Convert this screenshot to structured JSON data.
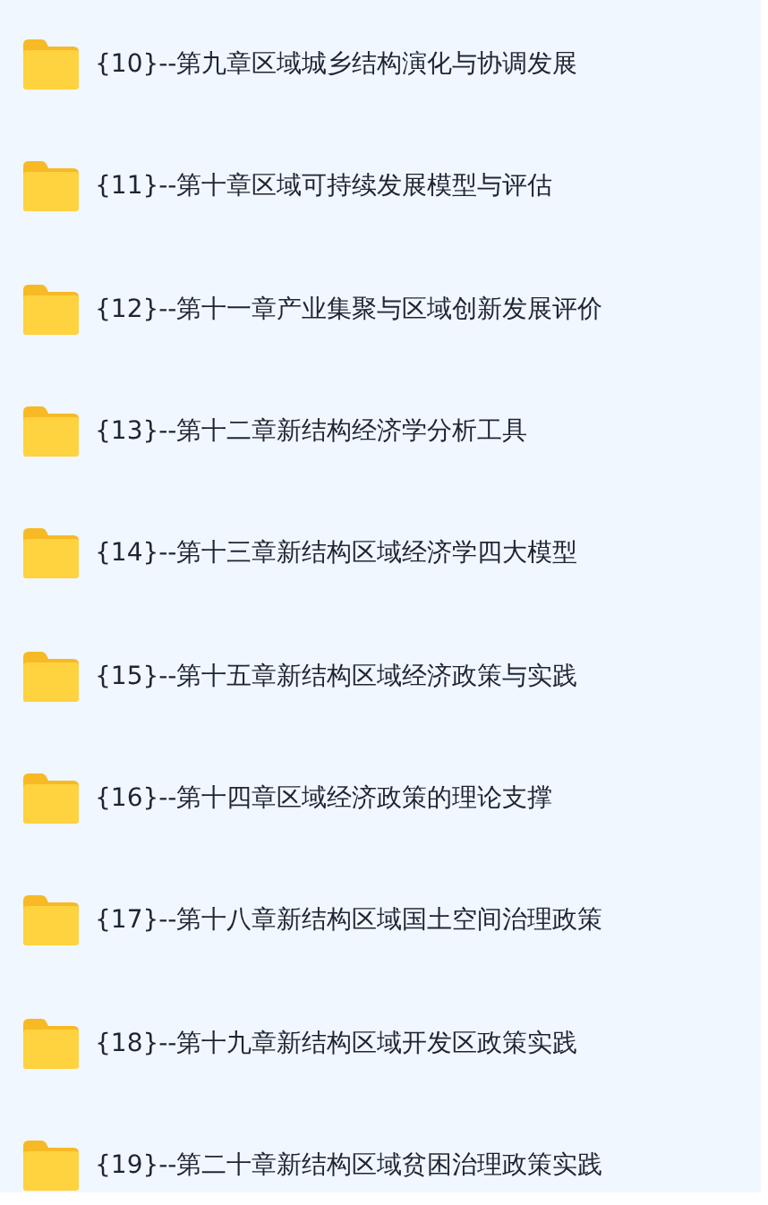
{
  "folders": [
    {
      "name": "{10}--第九章区域城乡结构演化与协调发展"
    },
    {
      "name": "{11}--第十章区域可持续发展模型与评估"
    },
    {
      "name": "{12}--第十一章产业集聚与区域创新发展评价"
    },
    {
      "name": "{13}--第十二章新结构经济学分析工具"
    },
    {
      "name": "{14}--第十三章新结构区域经济学四大模型"
    },
    {
      "name": "{15}--第十五章新结构区域经济政策与实践"
    },
    {
      "name": "{16}--第十四章区域经济政策的理论支撑"
    },
    {
      "name": "{17}--第十八章新结构区域国土空间治理政策"
    },
    {
      "name": "{18}--第十九章新结构区域开发区政策实践"
    },
    {
      "name": "{19}--第二十章新结构区域贫困治理政策实践"
    }
  ]
}
